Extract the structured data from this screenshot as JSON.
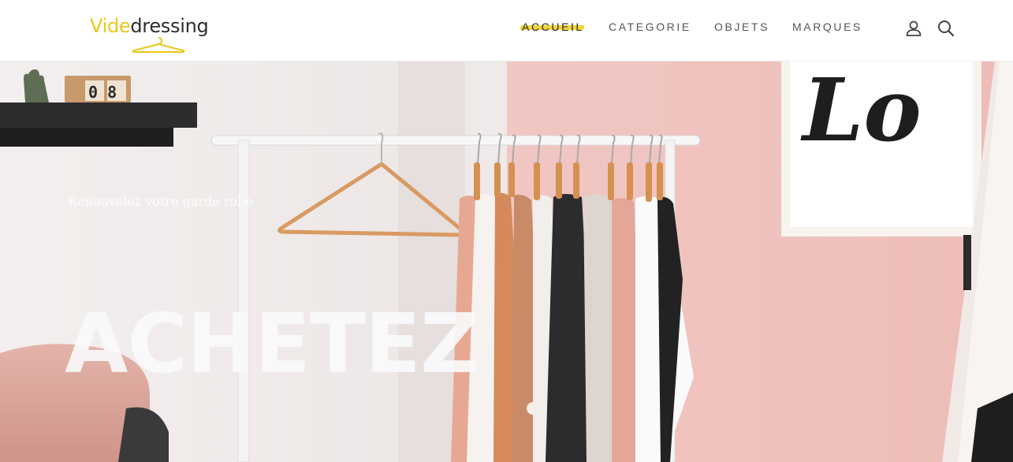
{
  "brand": {
    "logo_part1": "Vide",
    "logo_part2": "dressing",
    "accent_color": "#e9c81a"
  },
  "nav": {
    "items": [
      {
        "label": "ACCUEIL",
        "active": true
      },
      {
        "label": "CATEGORIE",
        "active": false
      },
      {
        "label": "OBJETS",
        "active": false
      },
      {
        "label": "MARQUES",
        "active": false
      }
    ]
  },
  "header_icons": [
    "user-icon",
    "search-icon"
  ],
  "hero": {
    "tagline": "Renouvelez votre garde robe",
    "title": "ACHETEZ",
    "wall_art_text": "Lo",
    "calendar_text": "0 8",
    "colors": {
      "pink_wall": "#f2c4c0",
      "white_wall": "#f4f0f0",
      "wood": "#d99a62"
    }
  }
}
